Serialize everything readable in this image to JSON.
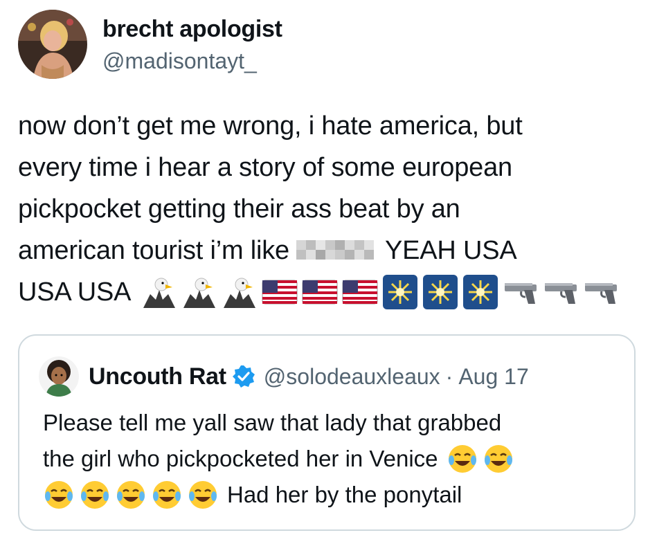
{
  "tweet": {
    "display_name": "brecht apologist",
    "handle": "@madisontayt_",
    "text_lines": [
      "now don’t get me wrong, i hate america, but",
      "every time i hear a story of some european",
      "pickpocket getting their ass beat by an",
      "american tourist i’m like",
      "YEAH USA",
      "USA USA"
    ],
    "emojis": [
      "eagle-icon",
      "eagle-icon",
      "eagle-icon",
      "us-flag-icon",
      "us-flag-icon",
      "us-flag-icon",
      "fireworks-icon",
      "fireworks-icon",
      "fireworks-icon",
      "pistol-icon",
      "pistol-icon",
      "pistol-icon"
    ]
  },
  "quote": {
    "display_name": "Uncouth Rat",
    "handle": "@solodeauxleaux",
    "separator": "·",
    "date": "Aug 17",
    "text_lines": [
      "Please tell me yall saw that lady that grabbed",
      "the girl who pickpocketed her in Venice",
      "Had her by the ponytail"
    ],
    "laugh_emoji": "face-with-tears-of-joy-icon"
  },
  "colors": {
    "text": "#0f1419",
    "secondary": "#536471",
    "border": "#cfd9de",
    "verified": "#1d9bf0"
  }
}
